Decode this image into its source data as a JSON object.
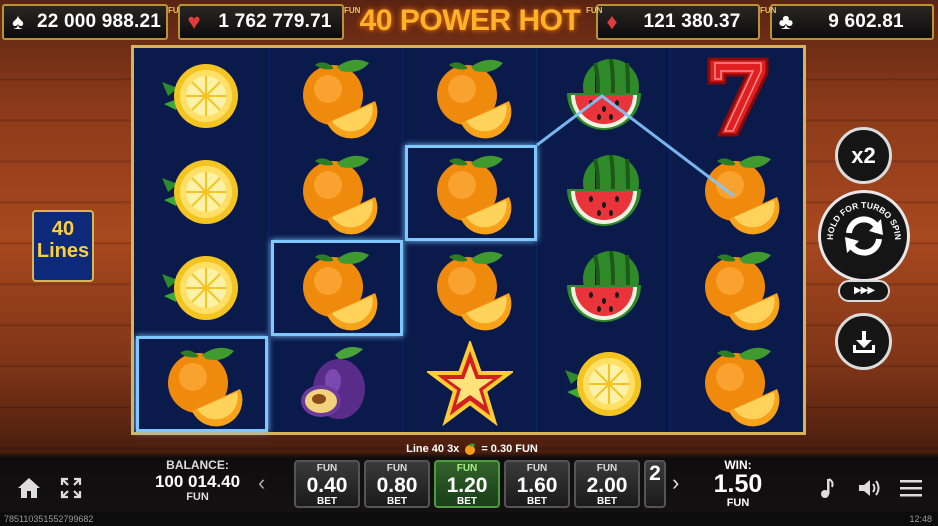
{
  "jackpots": [
    {
      "suit": "spade-icon",
      "glyph": "♠",
      "amount": "22 000 988.21",
      "fun": "FUN"
    },
    {
      "suit": "heart-icon",
      "glyph": "♥",
      "amount": "1 762 779.71",
      "fun": "FUN"
    },
    {
      "suit": "diamond-icon",
      "glyph": "♦",
      "amount": "121 380.37",
      "fun": "FUN"
    },
    {
      "suit": "club-icon",
      "glyph": "♣",
      "amount": "9 602.81",
      "fun": "FUN"
    }
  ],
  "title": "40 POWER HOT",
  "lines": {
    "count": "40",
    "label": "Lines"
  },
  "reels": [
    [
      "lemon",
      "lemon",
      "lemon",
      "orange"
    ],
    [
      "orange",
      "orange",
      "orange",
      "plum"
    ],
    [
      "orange",
      "orange",
      "orange",
      "star"
    ],
    [
      "watermelon",
      "watermelon",
      "watermelon",
      "lemon"
    ],
    [
      "seven",
      "orange",
      "orange",
      "orange"
    ]
  ],
  "win_line": {
    "line_label": "Line 40 3x",
    "amount": "= 0.30 FUN"
  },
  "multiplier": "x2",
  "spin_hint": "HOLD FOR TURBO SPIN",
  "turbo": "▶▶▶",
  "balance": {
    "label": "BALANCE:",
    "value": "100 014.40",
    "currency": "FUN"
  },
  "bets": [
    {
      "fun": "FUN",
      "value": "0.40",
      "label": "BET",
      "selected": false
    },
    {
      "fun": "FUN",
      "value": "0.80",
      "label": "BET",
      "selected": false
    },
    {
      "fun": "FUN",
      "value": "1.20",
      "label": "BET",
      "selected": true
    },
    {
      "fun": "FUN",
      "value": "1.60",
      "label": "BET",
      "selected": false
    },
    {
      "fun": "FUN",
      "value": "2.00",
      "label": "BET",
      "selected": false
    },
    {
      "fun": "",
      "value": "2",
      "label": "",
      "selected": false
    }
  ],
  "win": {
    "label": "WIN:",
    "value": "1.50",
    "currency": "FUN"
  },
  "footer": {
    "round_id": "785110351552799682",
    "time": "12:48"
  },
  "colors": {
    "frame": "#d8b458",
    "reel_bg": "#0a1a4a",
    "win_line": "#7fc8ff",
    "selected_bet": "#33622c",
    "title": "#ffb22a"
  }
}
